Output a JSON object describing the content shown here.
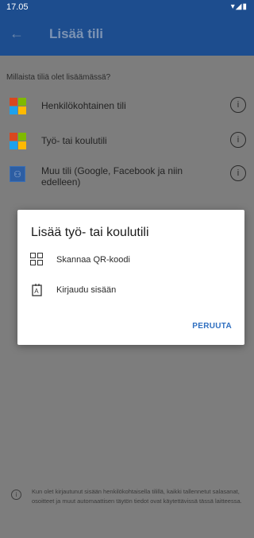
{
  "status_bar": {
    "time": "17.05",
    "icons": "▾◢▮"
  },
  "app_bar": {
    "back_icon": "←",
    "title": "Lisää tili"
  },
  "main": {
    "prompt": "Millaista tiliä olet lisäämässä?",
    "accounts": [
      {
        "label": "Henkilökohtainen tili",
        "icon": "microsoft-logo"
      },
      {
        "label": "Työ- tai koulutili",
        "icon": "microsoft-logo"
      },
      {
        "label": "Muu tili (Google, Facebook ja niin edelleen)",
        "icon": "person-icon"
      }
    ],
    "info_glyph": "i"
  },
  "dialog": {
    "title": "Lisää työ- tai koulutili",
    "options": [
      {
        "label": "Skannaa QR-koodi",
        "icon": "qr-code-icon"
      },
      {
        "label": "Kirjaudu sisään",
        "icon": "sign-in-icon"
      }
    ],
    "cancel_label": "PERUUTA"
  },
  "footer": {
    "note": "Kun olet kirjautunut sisään henkilökohtaisella tilillä, kaikki tallennetut salasanat, osoitteet ja muut automaattisen täytön tiedot ovat käytettävissä tässä laitteessa."
  },
  "colors": {
    "status_bar": "#1d4d8e",
    "accent": "#2f6fc0",
    "scrim": "#7d7d7d",
    "ms_red": "#d9471f",
    "ms_green": "#7fb900",
    "ms_blue": "#1ea1ec",
    "ms_yellow": "#ffb900"
  }
}
